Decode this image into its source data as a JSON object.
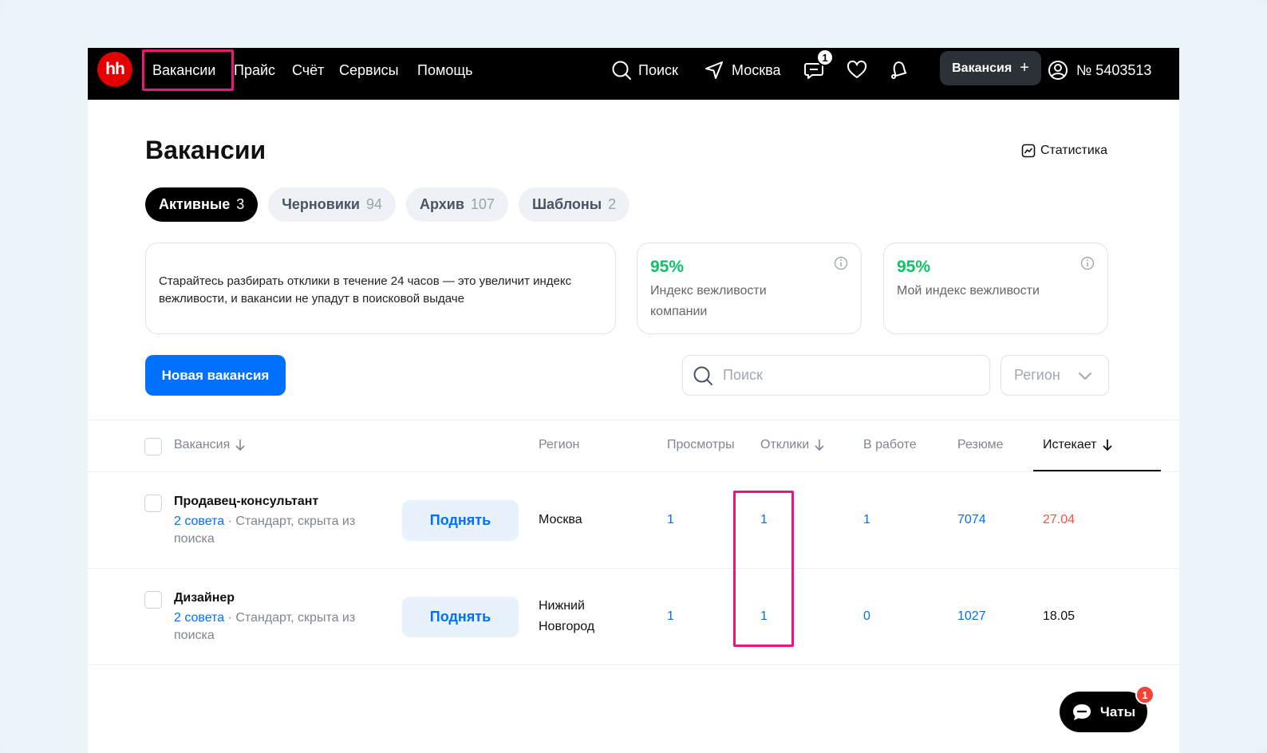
{
  "topbar": {
    "logo": "hh",
    "nav": [
      "Вакансии",
      "Прайс",
      "Счёт",
      "Сервисы",
      "Помощь"
    ],
    "search_label": "Поиск",
    "city": "Москва",
    "messages_badge": "1",
    "vacancy_button": "Вакансия",
    "vacancy_button_plus": "+",
    "account": "№ 5403513"
  },
  "page": {
    "title": "Вакансии",
    "stats_link": "Статистика"
  },
  "tabs": [
    {
      "label": "Активные",
      "count": "3"
    },
    {
      "label": "Черновики",
      "count": "94"
    },
    {
      "label": "Архив",
      "count": "107"
    },
    {
      "label": "Шаблоны",
      "count": "2"
    }
  ],
  "tip": "Старайтесь разбирать отклики в течение 24 часов — это увеличит индекс вежливости, и вакансии не упадут в поисковой выдаче",
  "indices": [
    {
      "value": "95%",
      "label": "Индекс вежливости компании"
    },
    {
      "value": "95%",
      "label": "Мой индекс вежливости"
    }
  ],
  "actions": {
    "new_vacancy": "Новая вакансия",
    "search_placeholder": "Поиск",
    "region_select": "Регион"
  },
  "table": {
    "headers": {
      "vacancy": "Вакансия",
      "region": "Регион",
      "views": "Просмотры",
      "responses": "Отклики",
      "in_work": "В работе",
      "resumes": "Резюме",
      "expires": "Истекает"
    },
    "rows": [
      {
        "name": "Продавец-консультант",
        "tips": "2 совета",
        "meta": " · Стандарт, скрыта из поиска",
        "raise": "Поднять",
        "region": "Москва",
        "views": "1",
        "responses": "1",
        "in_work": "1",
        "resumes": "7074",
        "expires": "27.04"
      },
      {
        "name": "Дизайнер",
        "tips": "2 совета",
        "meta": " · Стандарт, скрыта из поиска",
        "raise": "Поднять",
        "region": "Нижний Новгород",
        "views": "1",
        "responses": "1",
        "in_work": "0",
        "resumes": "1027",
        "expires": "18.05"
      }
    ]
  },
  "chat": {
    "label": "Чаты",
    "badge": "1"
  },
  "colors": {
    "brand_red": "#e40000",
    "primary_blue": "#0070ff",
    "success_green": "#0dc267",
    "expire_red": "#ff4d4d",
    "highlight_pink": "#e8177b"
  }
}
